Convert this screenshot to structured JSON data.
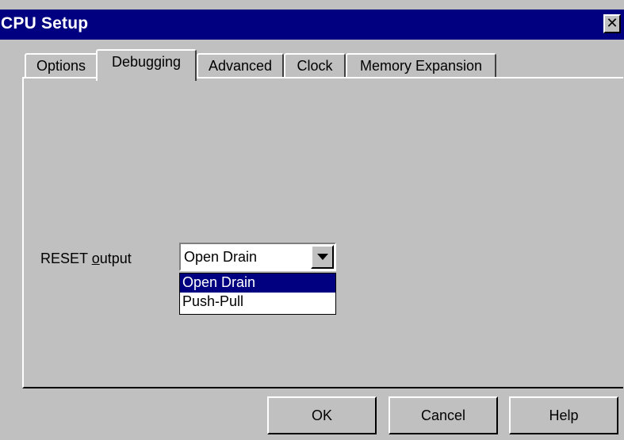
{
  "window": {
    "title": "CPU Setup",
    "close_glyph": "✕"
  },
  "tabs": [
    {
      "label": "Options",
      "active": false
    },
    {
      "label": "Debugging",
      "active": true
    },
    {
      "label": "Advanced",
      "active": false
    },
    {
      "label": "Clock",
      "active": false
    },
    {
      "label": "Memory Expansion",
      "active": false
    }
  ],
  "reset": {
    "label_prefix": "RESET ",
    "label_accel": "o",
    "label_suffix": "utput",
    "value": "Open Drain",
    "options": [
      "Open Drain",
      "Push-Pull"
    ],
    "selected_index": 0
  },
  "buttons": {
    "ok": "OK",
    "cancel": "Cancel",
    "help": "Help"
  },
  "colors": {
    "titlebar": "#000080",
    "face": "#c0c0c0",
    "highlight": "#000080"
  }
}
